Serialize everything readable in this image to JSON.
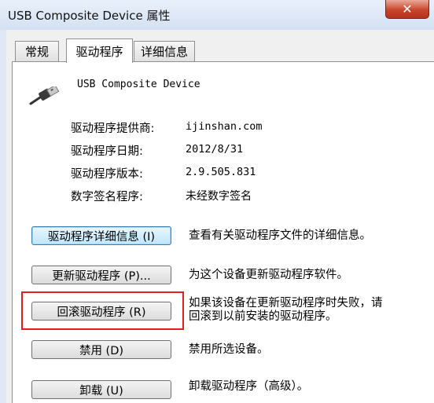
{
  "window": {
    "title": "USB Composite Device  属性",
    "close_glyph": "✕"
  },
  "tabs": [
    {
      "label": "常规",
      "active": false
    },
    {
      "label": "驱动程序",
      "active": true
    },
    {
      "label": "详细信息",
      "active": false
    }
  ],
  "device": {
    "name": "USB Composite Device",
    "icon": "usb-plug-icon"
  },
  "info": [
    {
      "label": "驱动程序提供商:",
      "value": "ijinshan.com"
    },
    {
      "label": "驱动程序日期:",
      "value": "2012/8/31"
    },
    {
      "label": "驱动程序版本:",
      "value": "2.9.505.831"
    },
    {
      "label": "数字签名程序:",
      "value": "未经数字签名"
    }
  ],
  "actions": [
    {
      "label": "驱动程序详细信息 (I)",
      "desc": "查看有关驱动程序文件的详细信息。"
    },
    {
      "label": "更新驱动程序 (P)...",
      "desc": "为这个设备更新驱动程序软件。"
    },
    {
      "label": "回滚驱动程序 (R)",
      "desc_line1": "如果该设备在更新驱动程序时失败，请",
      "desc_line2": "回滚到以前安装的驱动程序。"
    },
    {
      "label": "禁用 (D)",
      "desc": "禁用所选设备。"
    },
    {
      "label": "卸载 (U)",
      "desc": "卸载驱动程序（高级）。"
    }
  ],
  "colors": {
    "highlight_box": "#e02020",
    "close_button": "#c7452c"
  }
}
